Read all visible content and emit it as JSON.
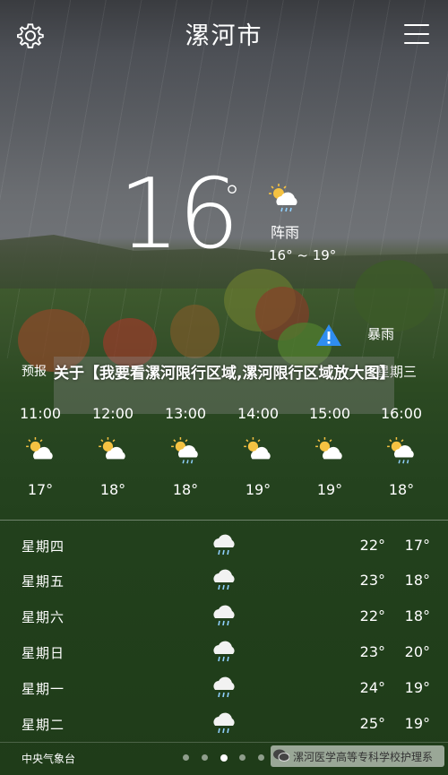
{
  "header": {
    "city": "漯河市",
    "settings_icon": "gear-icon",
    "menu_icon": "hamburger-menu-icon"
  },
  "current": {
    "temperature": "16",
    "degree_symbol": "°",
    "condition": "阵雨",
    "range": "16° ~ 19°",
    "icon": "sun-cloud-rain-icon"
  },
  "alert": {
    "icon": "warning-triangle-icon",
    "label": "暴雨"
  },
  "overlay": {
    "title": "关于【我要看漯河限行区域,漯河限行区域放大图】"
  },
  "forecast": {
    "label": "预报",
    "day_label": "星期三"
  },
  "hourly": [
    {
      "time": "11:00",
      "temp": "17°",
      "icon": "partly-cloudy-icon"
    },
    {
      "time": "12:00",
      "temp": "18°",
      "icon": "partly-cloudy-icon"
    },
    {
      "time": "13:00",
      "temp": "18°",
      "icon": "sun-cloud-rain-icon"
    },
    {
      "time": "14:00",
      "temp": "19°",
      "icon": "partly-cloudy-icon"
    },
    {
      "time": "15:00",
      "temp": "19°",
      "icon": "partly-cloudy-icon"
    },
    {
      "time": "16:00",
      "temp": "18°",
      "icon": "sun-cloud-rain-icon"
    }
  ],
  "daily": [
    {
      "day": "星期四",
      "high": "22°",
      "low": "17°",
      "icon": "rain-cloud-icon"
    },
    {
      "day": "星期五",
      "high": "23°",
      "low": "18°",
      "icon": "rain-cloud-icon"
    },
    {
      "day": "星期六",
      "high": "22°",
      "low": "18°",
      "icon": "rain-cloud-icon"
    },
    {
      "day": "星期日",
      "high": "23°",
      "low": "20°",
      "icon": "rain-cloud-icon"
    },
    {
      "day": "星期一",
      "high": "24°",
      "low": "19°",
      "icon": "rain-cloud-icon"
    },
    {
      "day": "星期二",
      "high": "25°",
      "low": "19°",
      "icon": "rain-cloud-icon"
    }
  ],
  "footer": {
    "source": "中央气象台",
    "page_count": 5,
    "active_page": 3,
    "watermark_text": "漯河医学高等专科学校护理系"
  },
  "colors": {
    "text": "#ffffff",
    "sun": "#f5c242",
    "cloud": "#ffffff",
    "rain": "#8fd0ff",
    "alert_blue": "#2f8df0"
  }
}
